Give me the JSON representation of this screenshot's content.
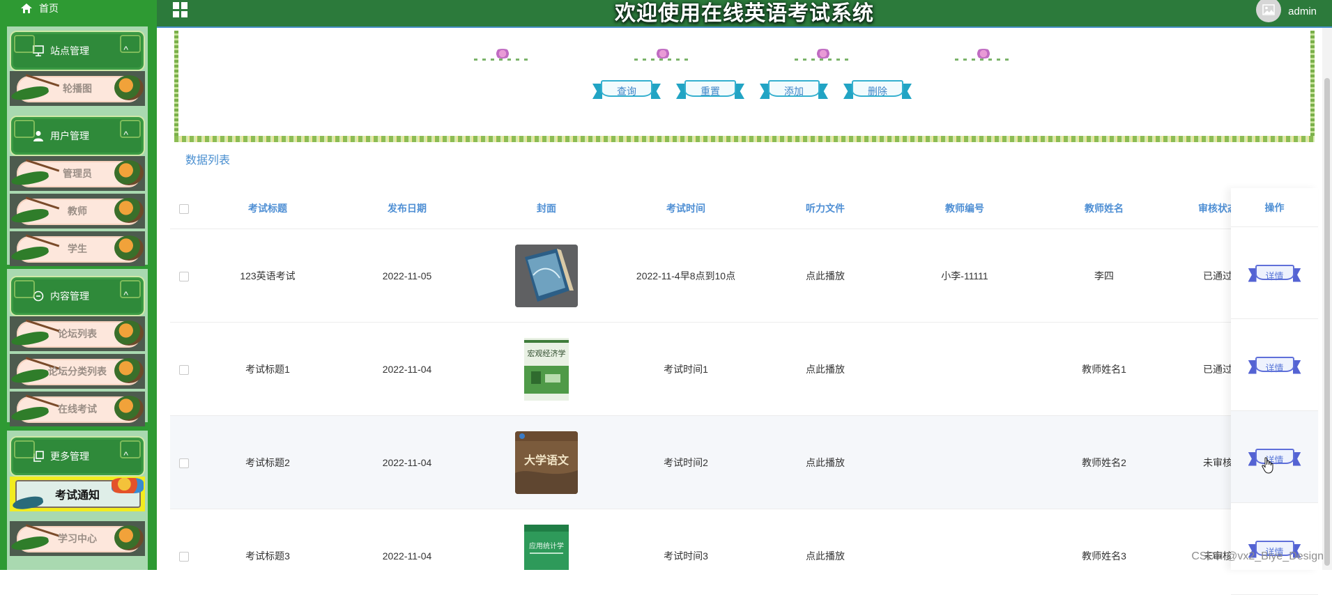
{
  "header": {
    "title": "欢迎使用在线英语考试系统",
    "username": "admin"
  },
  "sidebar": {
    "home": "首页",
    "groups": [
      {
        "label": "站点管理",
        "icon": "monitor-icon",
        "items": [
          "轮播图"
        ]
      },
      {
        "label": "用户管理",
        "icon": "user-icon",
        "items": [
          "管理员",
          "教师",
          "学生"
        ]
      },
      {
        "label": "内容管理",
        "icon": "chat-icon",
        "items": [
          "论坛列表",
          "论坛分类列表",
          "在线考试"
        ]
      },
      {
        "label": "更多管理",
        "icon": "copy-icon",
        "items": [
          "考试通知",
          "学习中心"
        ]
      }
    ],
    "active_item": "考试通知"
  },
  "actions": {
    "query": "查询",
    "reset": "重置",
    "add": "添加",
    "delete": "删除"
  },
  "list": {
    "title": "数据列表",
    "columns": [
      "考试标题",
      "发布日期",
      "封面",
      "考试时间",
      "听力文件",
      "教师编号",
      "教师姓名",
      "审核状态",
      "操作"
    ],
    "rows": [
      {
        "title": "123英语考试",
        "date": "2022-11-05",
        "cover": "cover-book-blue",
        "time": "2022-11-4早8点到10点",
        "audio": "点此播放",
        "teacher_no": "小李-11111",
        "teacher_name": "李四",
        "status": "已通过",
        "action": "详情"
      },
      {
        "title": "考试标题1",
        "date": "2022-11-04",
        "cover": "cover-book-green",
        "cover_text": "宏观经济学",
        "time": "考试时间1",
        "audio": "点此播放",
        "teacher_no": "",
        "teacher_name": "教师姓名1",
        "status": "已通过",
        "action": "详情"
      },
      {
        "title": "考试标题2",
        "date": "2022-11-04",
        "cover": "cover-book-brown",
        "cover_text": "大学语文",
        "time": "考试时间2",
        "audio": "点此播放",
        "teacher_no": "",
        "teacher_name": "教师姓名2",
        "status": "未审核",
        "action": "详情"
      },
      {
        "title": "考试标题3",
        "date": "2022-11-04",
        "cover": "cover-book-teal",
        "cover_text": "应用统计学",
        "time": "考试时间3",
        "audio": "点此播放",
        "teacher_no": "",
        "teacher_name": "教师姓名3",
        "status": "未审核",
        "action": "详情"
      }
    ]
  },
  "watermark": "CSDN @vx2_Biye_Design",
  "colors": {
    "sidebar_bg": "#2e9a33",
    "header_bg": "#2c7a3b",
    "header_text": "#4f8fd4",
    "active_item": "#f2ec1f"
  }
}
